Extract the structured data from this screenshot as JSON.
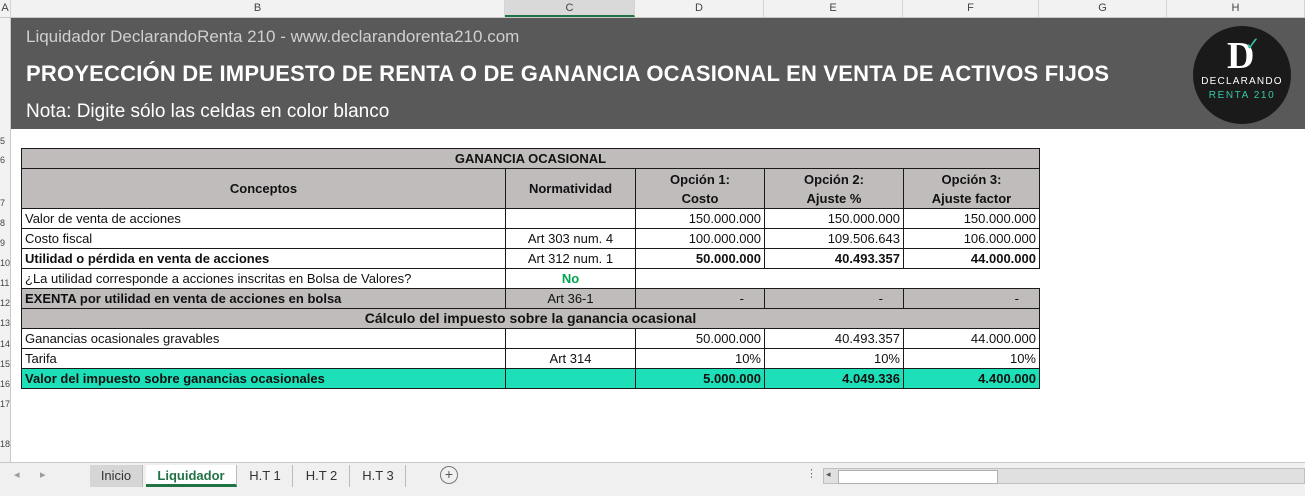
{
  "columns": [
    "A",
    "B",
    "C",
    "D",
    "E",
    "F",
    "G",
    "H"
  ],
  "rows": [
    "5",
    "6",
    "7",
    "8",
    "9",
    "10",
    "11",
    "12",
    "13",
    "14",
    "15",
    "16",
    "17",
    "18"
  ],
  "banner": {
    "subtitle": "Liquidador DeclarandoRenta 210 - www.declarandorenta210.com",
    "title": "PROYECCIÓN DE IMPUESTO DE RENTA O DE GANANCIA OCASIONAL EN VENTA DE ACTIVOS FIJOS",
    "note": "Nota: Digite sólo las celdas en color blanco",
    "logo_line1": "DECLARANDO",
    "logo_line2": "RENTA 210",
    "logo_letter": "D",
    "logo_check": "✓"
  },
  "table": {
    "section1_title": "GANANCIA OCASIONAL",
    "headers": {
      "concepts": "Conceptos",
      "norm": "Normatividad",
      "opt1_a": "Opción 1:",
      "opt1_b": "Costo",
      "opt2_a": "Opción 2:",
      "opt2_b": "Ajuste %",
      "opt3_a": "Opción 3:",
      "opt3_b": "Ajuste factor"
    },
    "rows": [
      {
        "concept": "Valor de venta de acciones",
        "norm": "",
        "v1": "150.000.000",
        "v2": "150.000.000",
        "v3": "150.000.000"
      },
      {
        "concept": "Costo fiscal",
        "norm": "Art 303 num. 4",
        "v1": "100.000.000",
        "v2": "109.506.643",
        "v3": "106.000.000"
      },
      {
        "concept": "Utilidad o pérdida en venta de acciones",
        "norm": "Art 312 num. 1",
        "v1": "50.000.000",
        "v2": "40.493.357",
        "v3": "44.000.000"
      },
      {
        "concept": "¿La utilidad corresponde a acciones inscritas en Bolsa de Valores?",
        "norm": "No"
      },
      {
        "concept": "EXENTA por utilidad en venta de acciones en bolsa",
        "norm": "Art 36-1",
        "v1": "-",
        "v2": "-",
        "v3": "-"
      }
    ],
    "section2_title": "Cálculo del impuesto sobre la ganancia ocasional",
    "rows2": [
      {
        "concept": "Ganancias ocasionales gravables",
        "norm": "",
        "v1": "50.000.000",
        "v2": "40.493.357",
        "v3": "44.000.000"
      },
      {
        "concept": "Tarifa",
        "norm": "Art 314",
        "v1": "10%",
        "v2": "10%",
        "v3": "10%"
      },
      {
        "concept": "Valor del impuesto sobre ganancias ocasionales",
        "norm": "",
        "v1": "5.000.000",
        "v2": "4.049.336",
        "v3": "4.400.000"
      }
    ]
  },
  "sheet_tabs": [
    "Inicio",
    "Liquidador",
    "H.T 1",
    "H.T 2",
    "H.T 3"
  ],
  "active_tab": "Liquidador",
  "colors": {
    "banner": "#595959",
    "gray_header": "#c0bcbc",
    "teal_total": "#1de0b8",
    "active_tab": "#217346"
  }
}
